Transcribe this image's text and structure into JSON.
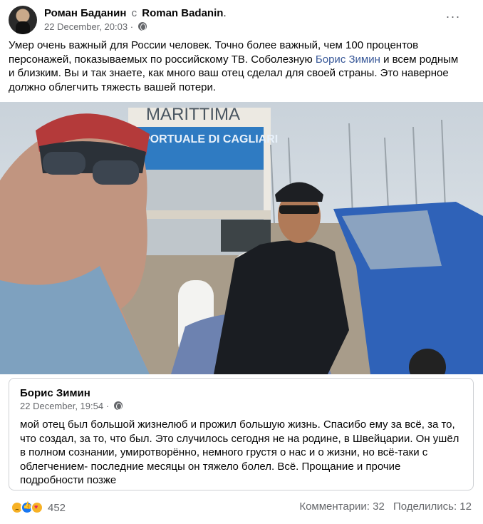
{
  "post": {
    "author": "Роман Баданин",
    "with_word": "с",
    "tagged": "Roman Badanin",
    "tagged_suffix": ".",
    "timestamp": "22 December, 20:03 ·",
    "more": "···",
    "text_part1": "Умер очень важный для России человек. Точно более важный, чем 100 процентов персонажей, показываемых по российскому ТВ. Соболезную ",
    "mention": "Борис Зимин",
    "text_part2": " и всем родным и близким. Вы и так знаете, как много ваш отец сделал для своей страны. Это наверное должно облегчить тяжесть вашей потери.",
    "photo_sign_line1": "MARITTIMA",
    "photo_sign_line2": "PORTUALE DI CAGLIARI"
  },
  "shared": {
    "author": "Борис Зимин",
    "timestamp": "22 December, 19:54 ·",
    "text": "мой отец был большой жизнелюб и прожил большую жизнь. Спасибо ему за всё, за то, что создал, за то, что был. Это случилось сегодня не на родине, в Швейцарии. Он ушёл в полном сознании, умиротворённо, немного грустя о нас и о жизни, но всё-таки с облегчением- последние месяцы он тяжело болел. Всё. Прощание и прочие подробности позже"
  },
  "footer": {
    "reaction_count": "452",
    "comments": "Комментарии: 32",
    "shares": "Поделились: 12"
  },
  "reaction_icons": [
    "sad-reaction-icon",
    "like-reaction-icon",
    "love-reaction-icon"
  ],
  "colors": {
    "link": "#385898",
    "muted": "#65676b",
    "border": "#ced0d4"
  }
}
